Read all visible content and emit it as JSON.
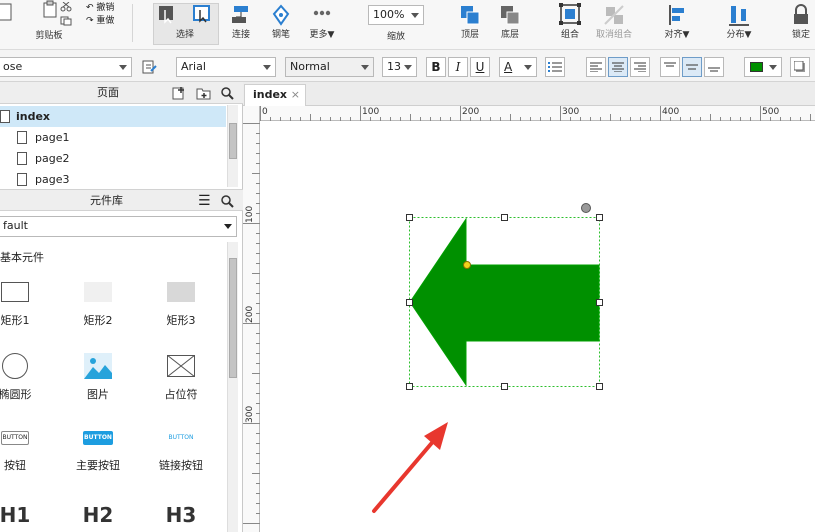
{
  "toolbar": {
    "undo": "撤销",
    "redo": "重做",
    "clipboard": "剪贴板",
    "select": "选择",
    "connect": "连接",
    "pen": "钢笔",
    "more": "更多▼",
    "zoom_value": "100%",
    "zoom": "缩放",
    "top_layer": "顶层",
    "bottom_layer": "底层",
    "group": "组合",
    "ungroup": "取消组合",
    "align": "对齐▼",
    "distribute": "分布▼",
    "lock": "锁定"
  },
  "format": {
    "style_value": "ose",
    "font_value": "Arial",
    "weight_value": "Normal",
    "size_value": "13",
    "bold": "B",
    "italic": "I",
    "underline": "U",
    "text_color_label": "A",
    "fill_color": "#009000"
  },
  "pages": {
    "header": "页面",
    "items": [
      "index",
      "page1",
      "page2",
      "page3"
    ]
  },
  "library": {
    "header": "元件库",
    "dropdown_value": "fault",
    "section": "基本元件",
    "items": [
      "矩形1",
      "矩形2",
      "矩形3",
      "椭圆形",
      "图片",
      "占位符",
      "按钮",
      "主要按钮",
      "链接按钮"
    ],
    "button_sample_text": "BUTTON",
    "headings": [
      "H1",
      "H2",
      "H3"
    ]
  },
  "canvas": {
    "tab": "index",
    "tab_close": "×",
    "hruler_labels": [
      "0",
      "100",
      "200",
      "300",
      "400",
      "500"
    ],
    "vruler_labels": [
      "100",
      "200",
      "300"
    ],
    "arrow_fill": "#009000"
  }
}
